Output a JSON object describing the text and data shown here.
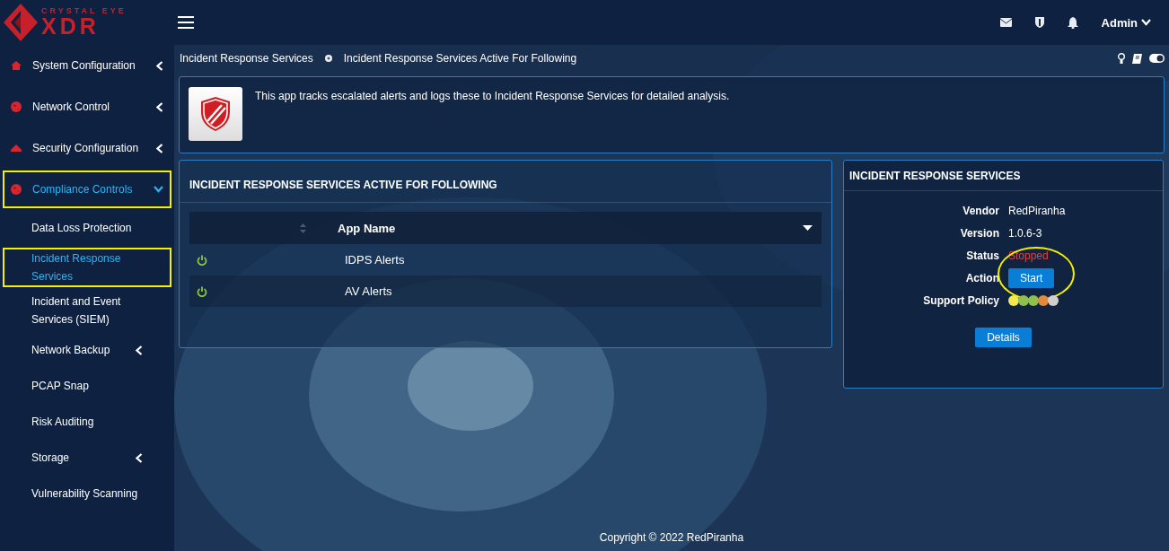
{
  "brand": {
    "tagline": "CRYSTAL EYE",
    "name": "XDR"
  },
  "header": {
    "user": "Admin"
  },
  "sidebar": {
    "items": [
      {
        "label": "System Configuration",
        "kind": "home",
        "expanded": false,
        "selected": false,
        "highlighted": false
      },
      {
        "label": "Network Control",
        "kind": "globe",
        "expanded": false,
        "selected": false,
        "highlighted": false
      },
      {
        "label": "Security Configuration",
        "kind": "cap",
        "expanded": false,
        "selected": false,
        "highlighted": false
      },
      {
        "label": "Compliance Controls",
        "kind": "globe",
        "expanded": true,
        "selected": true,
        "highlighted": true,
        "children": [
          {
            "label": "Data Loss Protection",
            "selected": false,
            "highlighted": false,
            "has_submenu": false
          },
          {
            "label": "Incident Response Services",
            "selected": true,
            "highlighted": true,
            "has_submenu": false
          },
          {
            "label": "Incident and Event Services (SIEM)",
            "selected": false,
            "highlighted": false,
            "has_submenu": false
          },
          {
            "label": "Network Backup",
            "selected": false,
            "highlighted": false,
            "has_submenu": true
          },
          {
            "label": "PCAP Snap",
            "selected": false,
            "highlighted": false,
            "has_submenu": false
          },
          {
            "label": "Risk Auditing",
            "selected": false,
            "highlighted": false,
            "has_submenu": false
          },
          {
            "label": "Storage",
            "selected": false,
            "highlighted": false,
            "has_submenu": true
          },
          {
            "label": "Vulnerability Scanning",
            "selected": false,
            "highlighted": false,
            "has_submenu": false
          }
        ]
      }
    ]
  },
  "breadcrumb": [
    "Incident Response Services",
    "Incident Response Services Active For Following"
  ],
  "intro": {
    "text": "This app tracks escalated alerts and logs these to Incident Response Services for detailed analysis."
  },
  "apps_panel": {
    "title": "INCIDENT RESPONSE SERVICES ACTIVE FOR FOLLOWING",
    "columns": [
      "App Name"
    ],
    "rows": [
      {
        "on": true,
        "name": "IDPS Alerts"
      },
      {
        "on": true,
        "name": "AV Alerts"
      }
    ]
  },
  "info_panel": {
    "title": "INCIDENT RESPONSE SERVICES",
    "fields": [
      {
        "label": "Vendor",
        "kind": "text",
        "value": "RedPiranha"
      },
      {
        "label": "Version",
        "kind": "text",
        "value": "1.0.6-3"
      },
      {
        "label": "Status",
        "kind": "status",
        "value": "Stopped"
      },
      {
        "label": "Action",
        "kind": "button",
        "value": "Start",
        "highlighted": true
      },
      {
        "label": "Support Policy",
        "kind": "dots",
        "dots": [
          {
            "color": "#f2e94e"
          },
          {
            "color": "#8fbf4f"
          },
          {
            "color": "#8fbf4f"
          },
          {
            "color": "#e28a3c"
          },
          {
            "color": "#cfcfcf"
          }
        ]
      }
    ],
    "button": "Details"
  },
  "footer": {
    "copyright": "Copyright © 2022 RedPiranha"
  }
}
